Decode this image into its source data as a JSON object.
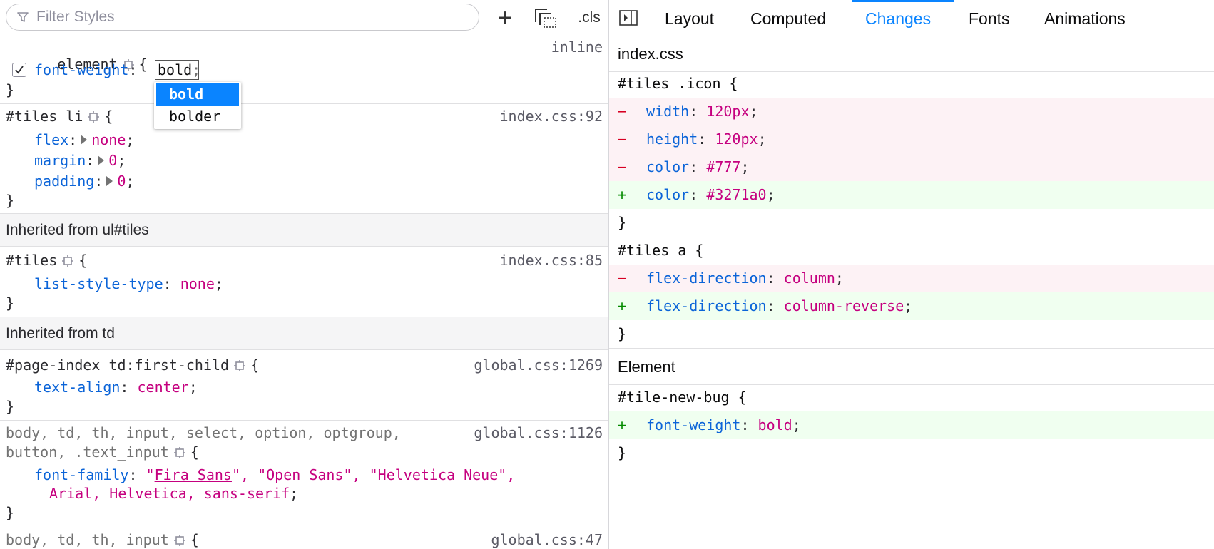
{
  "toolbar": {
    "filter_placeholder": "Filter Styles",
    "add_rule_label": "+",
    "cls_label": ".cls"
  },
  "rules": {
    "element": {
      "selector": "element",
      "brace_open": "{",
      "brace_close": "}",
      "source": "inline",
      "prop": "font-weight",
      "editing_value": "bold",
      "checked": true
    },
    "autocomplete": [
      "bold",
      "bolder"
    ],
    "tiles_li": {
      "selector": "#tiles li",
      "source": "index.css:92",
      "decls": [
        {
          "prop": "flex",
          "val": "none"
        },
        {
          "prop": "margin",
          "val": "0"
        },
        {
          "prop": "padding",
          "val": "0"
        }
      ]
    },
    "inherited_ul": "Inherited from ul#tiles",
    "tiles": {
      "selector": "#tiles",
      "source": "index.css:85",
      "prop": "list-style-type",
      "val": "none"
    },
    "inherited_td": "Inherited from td",
    "page_index": {
      "selector": "#page-index td:first-child",
      "source": "global.css:1269",
      "prop": "text-align",
      "val": "center"
    },
    "body_multi": {
      "selector_line1": "body, td, th, input, select, option, optgroup,",
      "selector_line2": "button, .text_input",
      "source": "global.css:1126",
      "prop": "font-family",
      "val_line1_a": "\"",
      "val_line1_link": "Fira Sans",
      "val_line1_b": "\", \"Open Sans\", \"Helvetica Neue\",",
      "val_line2": "Arial, Helvetica, sans-serif"
    },
    "body_input": {
      "selector": "body, td, th, input",
      "source": "global.css:47"
    }
  },
  "tabs": {
    "items": [
      "Layout",
      "Computed",
      "Changes",
      "Fonts",
      "Animations"
    ],
    "active": "Changes"
  },
  "changes": {
    "file_header": "index.css",
    "icon_rule": {
      "selector": "#tiles .icon {",
      "lines": [
        {
          "type": "remove",
          "marker": "−",
          "prop": "width",
          "val": "120px"
        },
        {
          "type": "remove",
          "marker": "−",
          "prop": "height",
          "val": "120px"
        },
        {
          "type": "remove",
          "marker": "−",
          "prop": "color",
          "val": "#777"
        },
        {
          "type": "add",
          "marker": "+",
          "prop": "color",
          "val": "#3271a0"
        }
      ],
      "close": "}"
    },
    "a_rule": {
      "selector": "#tiles a {",
      "lines": [
        {
          "type": "remove",
          "marker": "−",
          "prop": "flex-direction",
          "val": "column"
        },
        {
          "type": "add",
          "marker": "+",
          "prop": "flex-direction",
          "val": "column-reverse"
        }
      ],
      "close": "}"
    },
    "element_header": "Element",
    "element_rule": {
      "selector": "#tile-new-bug {",
      "lines": [
        {
          "type": "add",
          "marker": "+",
          "prop": "font-weight",
          "val": "bold"
        }
      ],
      "close": "}"
    }
  },
  "colors": {
    "accent": "#0a84ff",
    "property": "#0b64d8",
    "value": "#c5007f",
    "removed_bg": "#fdf2f5",
    "added_bg": "#f0fff0"
  }
}
